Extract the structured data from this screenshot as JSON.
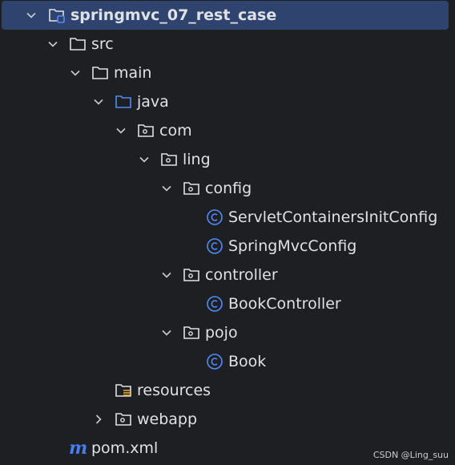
{
  "project": {
    "root": {
      "label": "springmvc_07_rest_case",
      "icon": "module-folder-icon"
    },
    "src": {
      "label": "src",
      "icon": "folder-icon"
    },
    "main": {
      "label": "main",
      "icon": "folder-icon"
    },
    "java": {
      "label": "java",
      "icon": "source-root-folder-icon"
    },
    "com": {
      "label": "com",
      "icon": "package-icon"
    },
    "ling": {
      "label": "ling",
      "icon": "package-icon"
    },
    "config": {
      "label": "config",
      "icon": "package-icon"
    },
    "servlet_config": {
      "label": "ServletContainersInitConfig",
      "icon": "class-icon"
    },
    "spring_config": {
      "label": "SpringMvcConfig",
      "icon": "class-icon"
    },
    "controller": {
      "label": "controller",
      "icon": "package-icon"
    },
    "book_controller": {
      "label": "BookController",
      "icon": "class-icon"
    },
    "pojo": {
      "label": "pojo",
      "icon": "package-icon"
    },
    "book": {
      "label": "Book",
      "icon": "class-icon"
    },
    "resources": {
      "label": "resources",
      "icon": "resources-folder-icon"
    },
    "webapp": {
      "label": "webapp",
      "icon": "web-folder-icon"
    },
    "pom": {
      "label": "pom.xml",
      "icon": "maven-icon"
    }
  },
  "colors": {
    "background": "#1e1f22",
    "selection": "#2e436e",
    "text": "#dfe1e5",
    "class_icon": "#548af7",
    "source_folder": "#548af7",
    "maven": "#4a7cf0"
  },
  "watermark": "CSDN @Ling_suu"
}
